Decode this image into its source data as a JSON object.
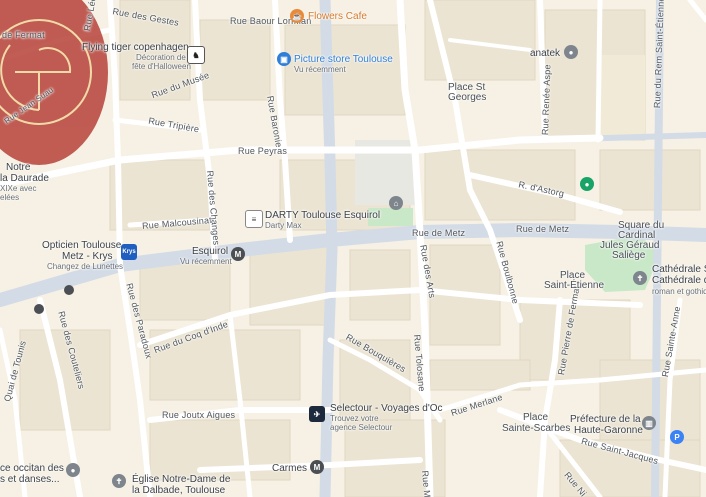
{
  "streets": {
    "rue_des_gestes": "Rue des Gestes",
    "rue_leon": "Rue Léon",
    "rue_baour_lormian": "Rue Baour Lormian",
    "rue_de_fermat_top": "de Fermat",
    "rue_baronie": "Rue Baronie",
    "rue_tripiere": "Rue Tripière",
    "rue_peyras": "Rue Peyras",
    "rue_malcousinat": "Rue Malcousinat",
    "rue_des_changes": "Rue des Changes",
    "rue_de_metz_1": "Rue de Metz",
    "rue_de_metz_2": "Rue de Metz",
    "rue_des_arts": "Rue des Arts",
    "rue_boulbonne": "Rue Boulbonne",
    "r_dastorg": "R. d'Astorg",
    "rue_renee_aspe": "Rue Renée Aspe",
    "rue_du_rem": "Rue du Rem Saint-Étienne",
    "rue_des_paradoux": "Rue des Paradoux",
    "rue_du_coq": "Rue du Coq d'Inde",
    "rue_des_couteliers": "Rue des Couteliers",
    "quai_de_tounis": "Quai de Tounis",
    "rue_bouqueres": "Rue Bouquières",
    "rue_tolosane": "Rue Tolosane",
    "rue_merlane": "Rue Merlane",
    "rue_pierre_de_fermat": "Rue Pierre de Fermat",
    "rue_sainte_anne": "Rue Sainte-Anne",
    "rue_joutx_aigues": "Rue Joutx Aigues",
    "rue_saint_jacques": "Rue Saint-Jacques",
    "rue_ninau": "Rue Ni",
    "rue_magenta": "Rue Ma",
    "rue_du_musee": "Rue du Musée",
    "rue_jean_suau": "Rue Jean Suau"
  },
  "pois": {
    "flowers_cafe": "Flowers Cafe",
    "flying_tiger": "Flying tiger copenhagen",
    "flying_tiger_sub1": "Décoration de",
    "flying_tiger_sub2": "fête d'Halloween",
    "picture_store": "Picture store Toulouse",
    "picture_store_sub": "Vu récemment",
    "anatek": "anatek",
    "place_st_georges_1": "Place St",
    "place_st_georges_2": "Georges",
    "darty": "DARTY Toulouse Esquirol",
    "darty_sub": "Darty Max",
    "opticien_1": "Opticien Toulouse",
    "opticien_2": "Metz - Krys",
    "opticien_sub": "Changez de Lunettes",
    "krys_badge": "Krys",
    "esquirol": "Esquirol",
    "esquirol_sub": "Vu récemment",
    "metro_letter": "M",
    "square_1": "Square du",
    "square_2": "Cardinal",
    "square_3": "Jules Géraud",
    "square_4": "Saliège",
    "place_st_etienne_1": "Place",
    "place_st_etienne_2": "Saint-Étienne",
    "cathedrale_1": "Cathédrale Sai",
    "cathedrale_2": "Cathédrale de Toulouse",
    "cathedrale_3": "roman et gothiq",
    "notre_dame_1": "Notre",
    "notre_dame_2": "la Daurade",
    "notre_dame_3": "XIXe avec",
    "notre_dame_4": "elées",
    "selectour": "Selectour - Voyages d'Oc",
    "selectour_sub1": "Trouvez votre",
    "selectour_sub2": "agence Selectour",
    "place_ss_1": "Place",
    "place_ss_2": "Sainte-Scarbes",
    "prefecture_1": "Préfecture de la",
    "prefecture_2": "Haute-Garonne",
    "carmes": "Carmes",
    "occitan_1": "ce occitan des",
    "occitan_2": "s et danses...",
    "dalbade_1": "Église Notre-Dame de",
    "dalbade_2": "la Dalbade, Toulouse",
    "parking": "P",
    "logo_text": "de Jean Suau"
  },
  "colors": {
    "background": "#f6f1e4",
    "road": "#ffffff",
    "road_major": "#d2dbe6",
    "block": "#ebe4d2",
    "park": "#c9e8c8",
    "plaza": "#e6e6e1",
    "metro_bg": "#4b4f54",
    "logo": "#b8473e",
    "logo_line": "#f2d7a0",
    "poi_orange": "#e98a38",
    "poi_blue": "#2f7fd8",
    "poi_gray": "#7e858c",
    "poi_green": "#18a367",
    "krys": "#1f5fbf"
  }
}
